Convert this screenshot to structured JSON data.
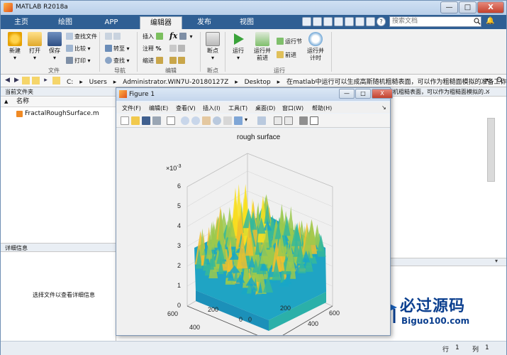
{
  "window": {
    "title": "MATLAB R2018a",
    "min_label": "—",
    "max_label": "□",
    "close_label": "X"
  },
  "tabs": [
    {
      "label": "主页"
    },
    {
      "label": "绘图"
    },
    {
      "label": "APP"
    },
    {
      "label": "编辑器"
    },
    {
      "label": "发布"
    },
    {
      "label": "视图"
    }
  ],
  "quick_access": {
    "help_label": "?"
  },
  "search": {
    "placeholder": "搜索文档"
  },
  "ribbon": {
    "file_group": {
      "new_label": "新建",
      "open_label": "打开",
      "save_label": "保存",
      "find_files_label": "查找文件",
      "compare_label": "比较",
      "print_label": "打印",
      "group_label": "文件"
    },
    "nav_group": {
      "goto_label": "转至",
      "find_label": "查找",
      "group_label": "导航"
    },
    "edit_group": {
      "insert_label": "插入",
      "comment_label": "注释",
      "indent_label": "缩进",
      "fx_label": "fx",
      "percent_label": "%",
      "group_label": "编辑"
    },
    "breakpoint_group": {
      "breakpoints_label": "断点",
      "group_label": "断点"
    },
    "run_group": {
      "run_label": "运行",
      "run_advance_label_1": "运行并",
      "run_advance_label_2": "前进",
      "run_section_label": "运行节",
      "advance_label": "前进",
      "run_time_label_1": "运行并",
      "run_time_label_2": "计时",
      "group_label": "运行"
    }
  },
  "address": {
    "segments": [
      "C:",
      "▸",
      "Users",
      "▸",
      "Administrator.WIN7U-20180127Z",
      "▸",
      "Desktop",
      "▸",
      "在matlab中运行可以生成高斯随机粗糙表面，可以作为粗糙面模拟的准备工作"
    ]
  },
  "left_panel": {
    "current_folder_title": "当前文件夹",
    "name_column": "名称",
    "sort_arrow": "▲",
    "files": [
      {
        "name": "FractalRoughSurface.m"
      }
    ],
    "details_title": "详细信息",
    "details_message": "选择文件以查看详细信息"
  },
  "editor": {
    "tab_text": "机粗糙表面，可以作为粗糙面模拟的..."
  },
  "status": {
    "row_label": "行",
    "row_value": "1",
    "col_label": "列",
    "col_value": "1"
  },
  "figure": {
    "title": "Figure 1",
    "menu": [
      {
        "label": "文件(F)"
      },
      {
        "label": "编辑(E)"
      },
      {
        "label": "查看(V)"
      },
      {
        "label": "插入(I)"
      },
      {
        "label": "工具(T)"
      },
      {
        "label": "桌面(D)"
      },
      {
        "label": "窗口(W)"
      },
      {
        "label": "帮助(H)"
      }
    ],
    "plot_title": "rough surface",
    "exponent_label": "×10",
    "exponent_sup": "-3",
    "z_ticks": [
      "6",
      "5",
      "4",
      "3",
      "2",
      "1",
      "0"
    ],
    "y_ticks": [
      "600",
      "400",
      "200",
      "0"
    ],
    "x_ticks": [
      "0",
      "200",
      "400",
      "600"
    ],
    "colormap": [
      "#3f2b8a",
      "#2d73c9",
      "#19a7c7",
      "#36b99a",
      "#9bc94d",
      "#f2c02c",
      "#f9e11e"
    ]
  },
  "watermark": {
    "cn_text": "必过源码",
    "en_text": "Biguo100.com"
  }
}
